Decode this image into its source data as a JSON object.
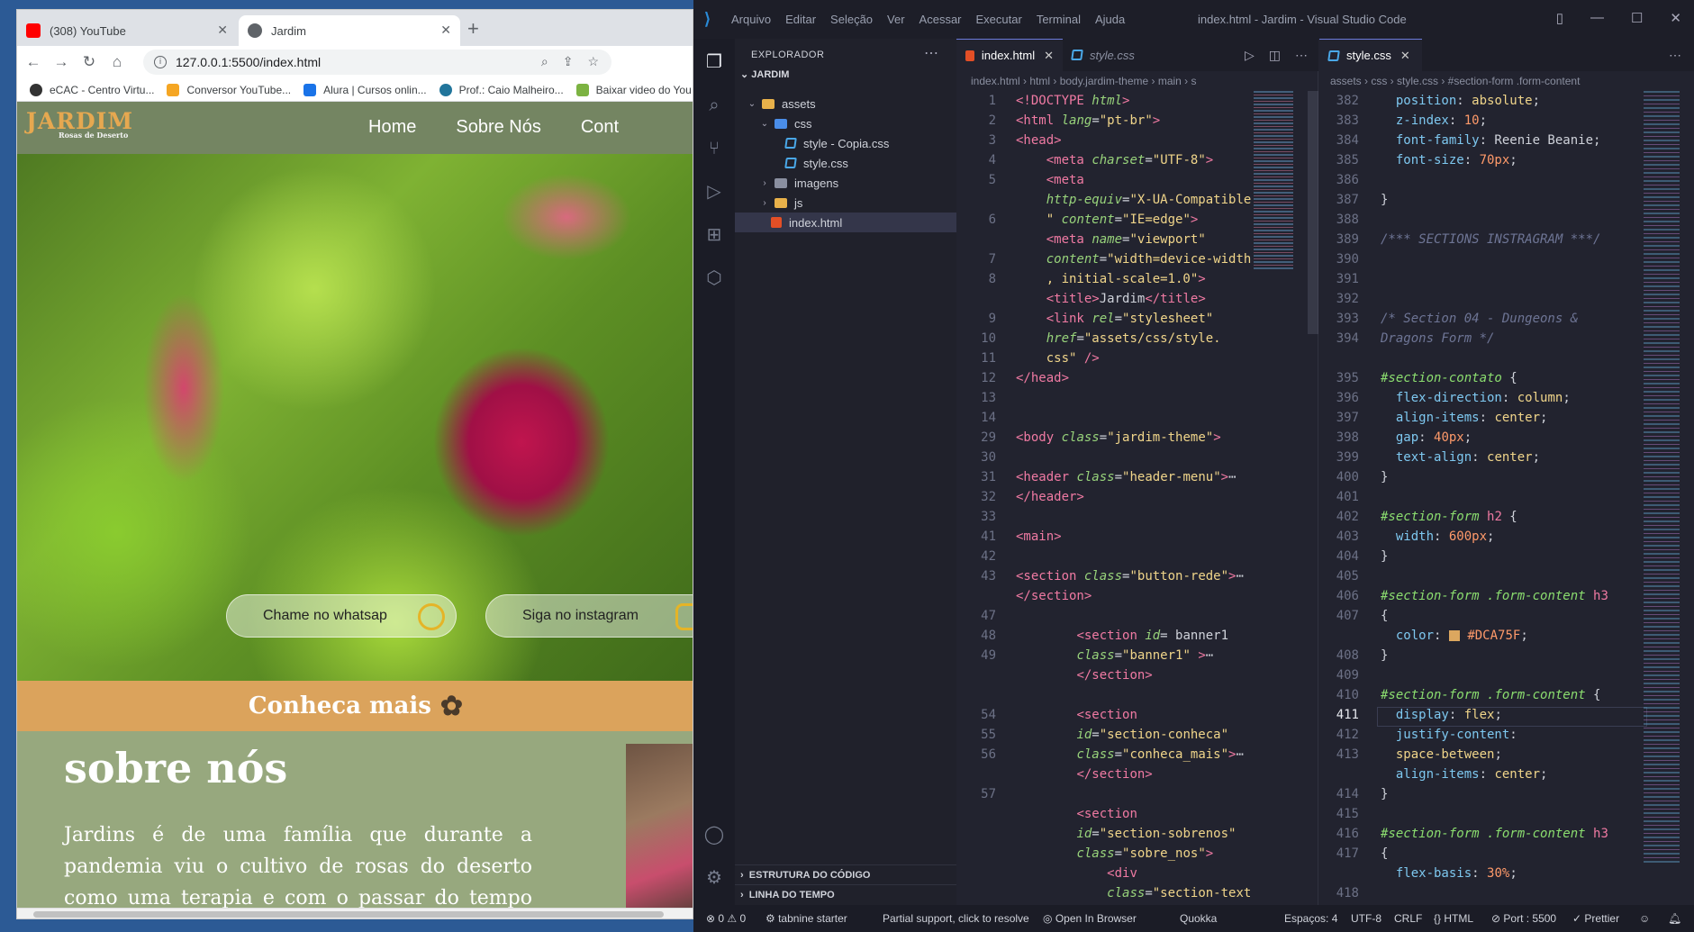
{
  "browser": {
    "tabs": [
      {
        "title": "(308) YouTube"
      },
      {
        "title": "Jardim"
      }
    ],
    "new_tab": "+",
    "url": "127.0.0.1:5500/index.html",
    "bookmarks": [
      "eCAC - Centro Virtu...",
      "Conversor YouTube...",
      "Alura | Cursos onlin...",
      "Prof.: Caio Malheiro...",
      "Baixar video do You"
    ]
  },
  "site": {
    "logo_main": "JARDIM",
    "logo_sub": "Rosas de Deserto",
    "nav": [
      "Home",
      "Sobre Nós",
      "Cont"
    ],
    "buttons": {
      "whatsapp": "Chame no whatsap",
      "instagram": "Siga no instagram"
    },
    "conheca": "Conheca mais",
    "sobre_title": "sobre nós",
    "sobre_text": "Jardins é de uma família que durante a pandemia viu o cultivo de rosas do deserto como uma terapia e com o passar do tempo foi"
  },
  "vscode": {
    "menus": [
      "Arquivo",
      "Editar",
      "Seleção",
      "Ver",
      "Acessar",
      "Executar",
      "Terminal",
      "Ajuda"
    ],
    "window_title": "index.html - Jardim - Visual Studio Code",
    "explorer": {
      "header": "EXPLORADOR",
      "root": "JARDIM",
      "items": [
        "assets",
        "css",
        "style - Copia.css",
        "style.css",
        "imagens",
        "js",
        "index.html"
      ],
      "sections": [
        "ESTRUTURA DO CÓDIGO",
        "LINHA DO TEMPO"
      ]
    },
    "editor1": {
      "tabs": [
        "index.html",
        "style.css"
      ],
      "breadcrumb": "index.html › html › body.jardim-theme › main › s"
    },
    "editor2": {
      "tabs": [
        "style.css"
      ],
      "breadcrumb": "assets › css › style.css › #section-form .form-content"
    },
    "status": {
      "problems": "⊗ 0 ⚠ 0",
      "tabnine": "tabnine starter",
      "partial": "Partial support, click to resolve",
      "browser": "Open In Browser",
      "quokka": "Quokka",
      "spaces": "Espaços: 4",
      "encoding": "UTF-8",
      "eol": "CRLF",
      "language": "HTML",
      "port": "Port : 5500",
      "prettier": "✓ Prettier"
    }
  }
}
